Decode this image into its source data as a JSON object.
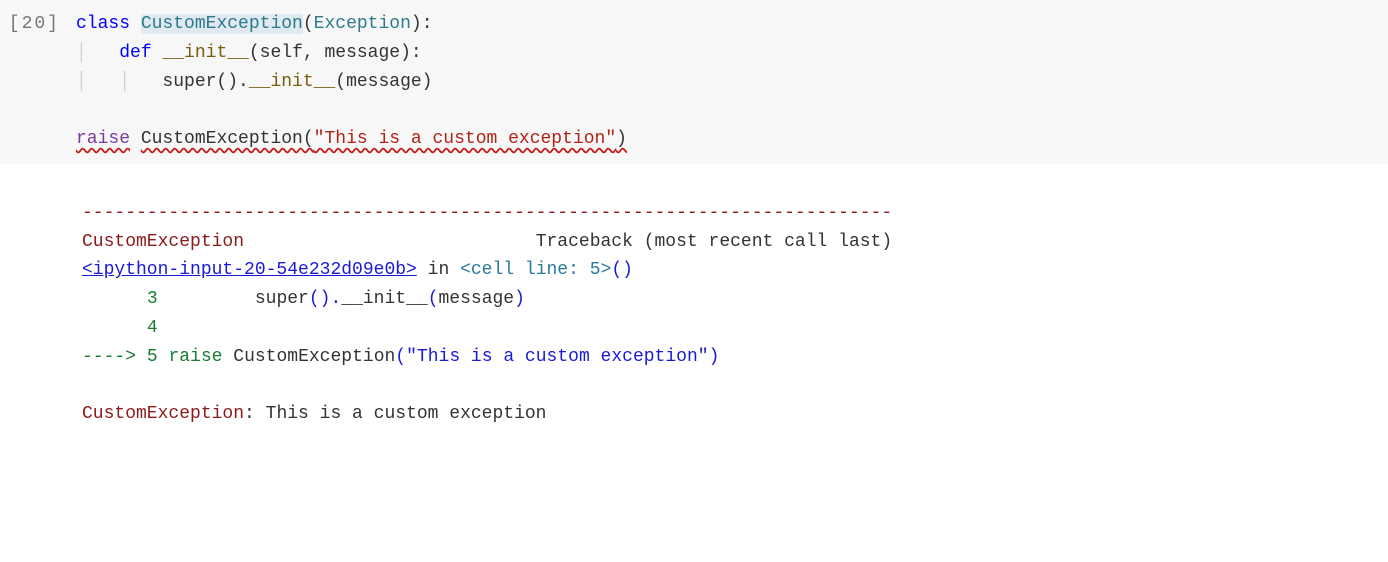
{
  "cell": {
    "prompt": "[20]",
    "code": {
      "line1": {
        "kw_class": "class",
        "classname": "CustomException",
        "paren_open": "(",
        "base": "Exception",
        "paren_close": "):"
      },
      "line2": {
        "kw_def": "def",
        "funcname": "__init__",
        "params": "(self, message):"
      },
      "line3": {
        "super_call": "super().",
        "init": "__init__",
        "args": "(message)"
      },
      "line4": "",
      "line5": {
        "raise_kw": "raise",
        "call_name": "CustomException",
        "call_open": "(",
        "string_literal": "\"This is a custom exception\"",
        "call_close": ")"
      }
    }
  },
  "output": {
    "dashes": "---------------------------------------------------------------------------",
    "exc_name": "CustomException",
    "tb_header": "Traceback (most recent call last)",
    "link": "<ipython-input-20-54e232d09e0b>",
    "in_word": " in ",
    "cell_line": "<cell line: 5>",
    "empty_paren": "()",
    "frame1": {
      "lineno": "3",
      "code_text": "super",
      "paren1": "().",
      "init": "__init__",
      "paren2": "(",
      "arg": "message",
      "paren3": ")"
    },
    "frame2": {
      "lineno": "4"
    },
    "frame3": {
      "arrow": "----> ",
      "lineno": "5",
      "raise_kw": "raise",
      "classname": "CustomException",
      "paren_open": "(",
      "string": "\"This is a custom exception\"",
      "paren_close": ")"
    },
    "final": {
      "exc_name": "CustomException",
      "colon": ": ",
      "message": "This is a custom exception"
    }
  }
}
